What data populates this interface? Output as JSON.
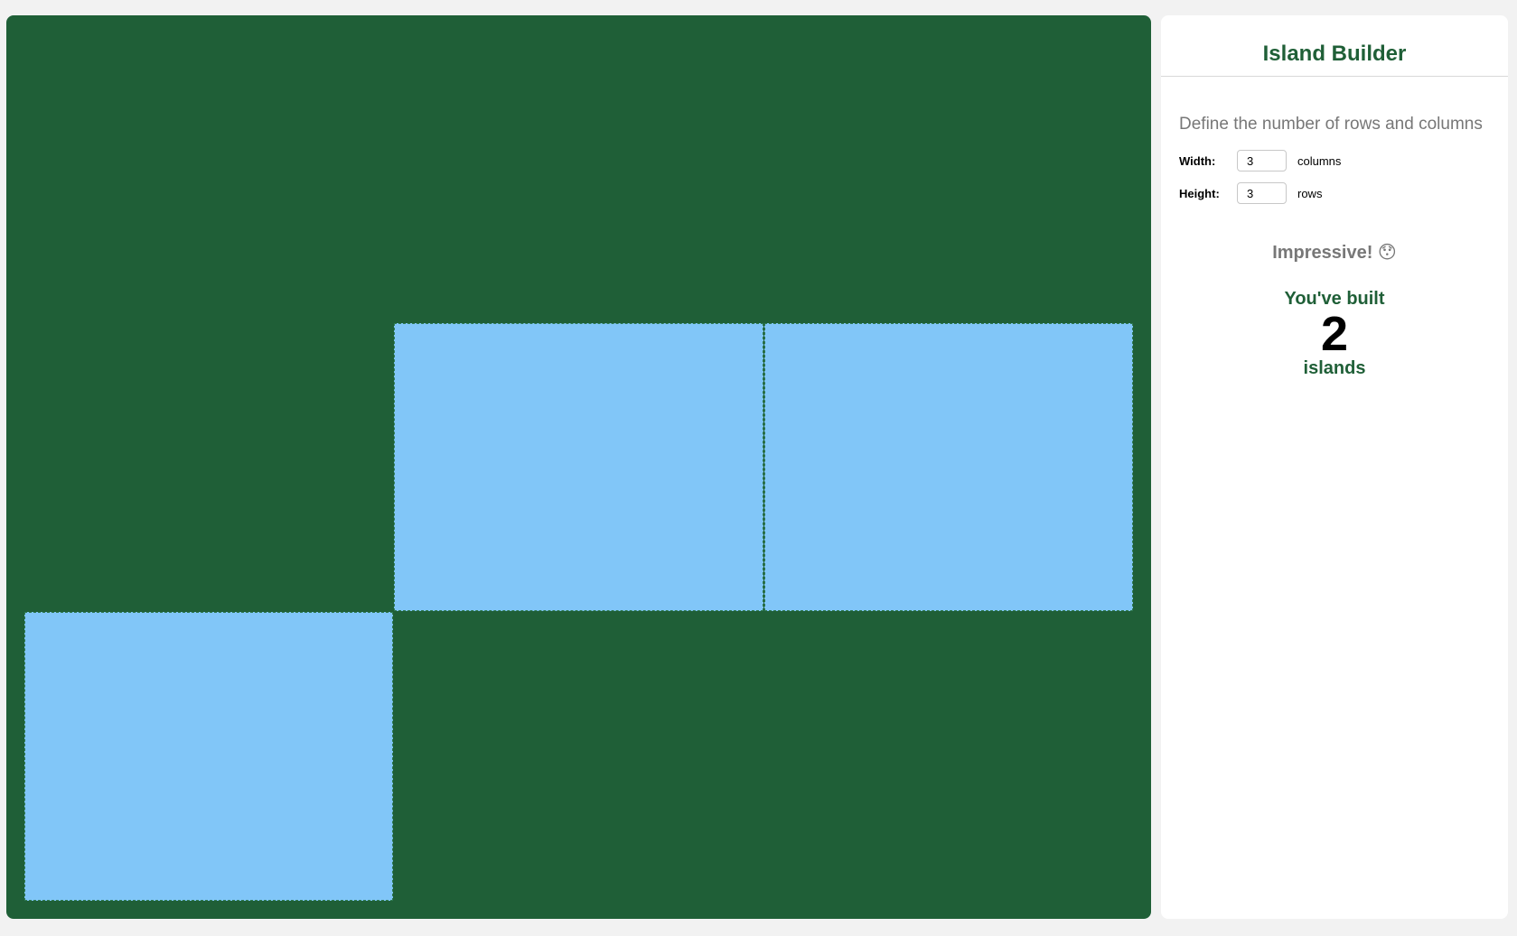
{
  "app": {
    "title": "Island Builder"
  },
  "controls": {
    "description": "Define the number of rows and columns",
    "width_label": "Width:",
    "width_value": "3",
    "width_unit": "columns",
    "height_label": "Height:",
    "height_value": "3",
    "height_unit": "rows"
  },
  "feedback": {
    "message": "Impressive! 😯"
  },
  "result": {
    "prefix": "You've built",
    "count": "2",
    "suffix": "islands"
  },
  "grid": {
    "rows": 3,
    "columns": 3,
    "cells": [
      [
        0,
        0,
        0
      ],
      [
        0,
        1,
        1
      ],
      [
        1,
        0,
        0
      ]
    ]
  },
  "colors": {
    "water": "#1f5f37",
    "land": "#81c6f8",
    "accent": "#1f5f37"
  }
}
